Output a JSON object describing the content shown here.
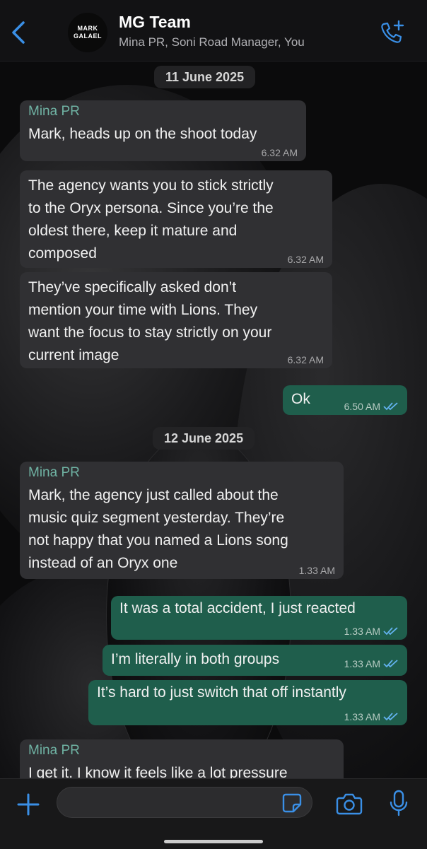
{
  "header": {
    "title": "MG Team",
    "members": "Mina PR, Soni Road Manager, You",
    "avatar_line1": "MARK",
    "avatar_line2": "GALAEL"
  },
  "messages": [
    {
      "type": "date",
      "label": "11 June 2025"
    },
    {
      "type": "in",
      "sender": "Mina PR",
      "text": "Mark, heads up on the shoot today",
      "time": "6.32 AM"
    },
    {
      "type": "in",
      "text": "The agency wants you to stick strictly\nto the Oryx persona. Since you’re the\noldest there, keep it mature and\ncomposed",
      "time": "6.32 AM"
    },
    {
      "type": "in",
      "text": "They’ve specifically asked don’t\nmention your time with Lions. They\nwant the focus to stay strictly on your\ncurrent image",
      "time": "6.32 AM"
    },
    {
      "type": "out",
      "text": "Ok",
      "time": "6.50 AM",
      "status": "read"
    },
    {
      "type": "date",
      "label": "12 June 2025"
    },
    {
      "type": "in",
      "sender": "Mina PR",
      "text": "Mark, the agency just called about the\nmusic quiz segment yesterday. They’re\nnot happy that you named a Lions song\ninstead of an Oryx one",
      "time": "1.33 AM"
    },
    {
      "type": "out",
      "text": "It was a total accident, I just reacted",
      "time": "1.33 AM",
      "status": "read"
    },
    {
      "type": "out",
      "text": "I’m literally in both groups",
      "time": "1.33 AM",
      "status": "read"
    },
    {
      "type": "out",
      "text": "It’s hard to just switch that off instantly",
      "time": "1.33 AM",
      "status": "read"
    },
    {
      "type": "in",
      "sender": "Mina PR",
      "text": "I get it. I know it feels like a lot pressure",
      "time": ""
    }
  ],
  "composer": {
    "placeholder": "",
    "value": ""
  },
  "colors": {
    "accent": "#3a8fe6",
    "outgoing_bubble": "#1f5e4c",
    "incoming_bubble": "#303033",
    "sender_name": "#6fb2a3",
    "read_ticks": "#63b3f0"
  },
  "icons": {
    "back": "chevron-left-icon",
    "call": "phone-plus-icon",
    "attach": "plus-icon",
    "sticker": "sticker-icon",
    "camera": "camera-icon",
    "mic": "microphone-icon",
    "read": "double-check-icon"
  }
}
